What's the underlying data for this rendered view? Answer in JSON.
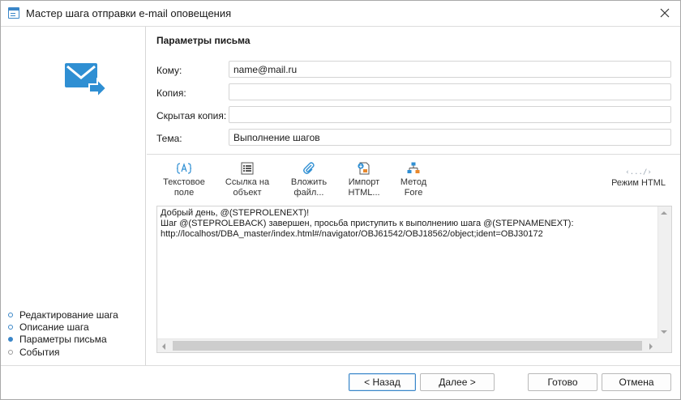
{
  "window": {
    "title": "Мастер шага отправки e-mail оповещения"
  },
  "sidebar": {
    "steps": [
      {
        "label": "Редактирование шага",
        "state": "done"
      },
      {
        "label": "Описание шага",
        "state": "done"
      },
      {
        "label": "Параметры письма",
        "state": "active"
      },
      {
        "label": "События",
        "state": "disabled"
      }
    ]
  },
  "main": {
    "section_title": "Параметры письма",
    "fields": {
      "to": {
        "label": "Кому:",
        "value": "name@mail.ru"
      },
      "cc": {
        "label": "Копия:",
        "value": ""
      },
      "bcc": {
        "label": "Скрытая копия:",
        "value": ""
      },
      "subject": {
        "label": "Тема:",
        "value": "Выполнение шагов"
      }
    },
    "toolbar": {
      "text_field": {
        "line1": "Текстовое",
        "line2": "поле",
        "icon": "text-field-icon"
      },
      "object_link": {
        "line1": "Ссылка на",
        "line2": "объект",
        "icon": "object-link-icon"
      },
      "attach_file": {
        "line1": "Вложить",
        "line2": "файл...",
        "icon": "paperclip-icon"
      },
      "import_html": {
        "line1": "Импорт",
        "line2": "HTML...",
        "icon": "import-html-icon"
      },
      "fore_method": {
        "line1": "Метод",
        "line2": "Fore",
        "icon": "fore-method-icon"
      },
      "html_mode": {
        "label": "Режим HTML",
        "icon_text": "‹.../›"
      }
    },
    "editor": {
      "lines": [
        "Добрый день, @(STEPROLENEXT)!",
        "Шаг @(STEPROLEBACK) завершен, просьба приступить к выполнению шага @(STEPNAMENEXT):",
        "http://localhost/DBA_master/index.html#/navigator/OBJ61542/OBJ18562/object;ident=OBJ30172"
      ]
    }
  },
  "footer": {
    "back": "< Назад",
    "next": "Далее >",
    "finish": "Готово",
    "cancel": "Отмена"
  },
  "colors": {
    "accent": "#3a86c8",
    "toolbar_icon_orange": "#e8882c"
  }
}
